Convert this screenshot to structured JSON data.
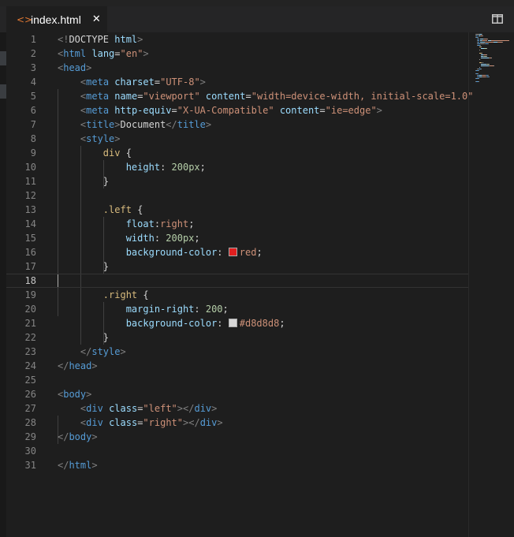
{
  "tab": {
    "icon": "code-file-icon",
    "icon_glyph": "<>",
    "filename": "index.html",
    "close_glyph": "✕"
  },
  "editor": {
    "current_line": 18,
    "lines": [
      {
        "n": "1",
        "tokens": [
          [
            "punc",
            "<!"
          ],
          [
            "txt",
            "DOCTYPE "
          ],
          [
            "attr",
            "html"
          ],
          [
            "punc",
            ">"
          ]
        ]
      },
      {
        "n": "2",
        "tokens": [
          [
            "punc",
            "<"
          ],
          [
            "tag",
            "html"
          ],
          [
            "txt",
            " "
          ],
          [
            "attr",
            "lang"
          ],
          [
            "txt",
            "="
          ],
          [
            "str",
            "\"en\""
          ],
          [
            "punc",
            ">"
          ]
        ]
      },
      {
        "n": "3",
        "tokens": [
          [
            "punc",
            "<"
          ],
          [
            "tag",
            "head"
          ],
          [
            "punc",
            ">"
          ]
        ]
      },
      {
        "n": "4",
        "tokens": [
          [
            "txt",
            "    "
          ],
          [
            "punc",
            "<"
          ],
          [
            "tag",
            "meta"
          ],
          [
            "txt",
            " "
          ],
          [
            "attr",
            "charset"
          ],
          [
            "txt",
            "="
          ],
          [
            "str",
            "\"UTF-8\""
          ],
          [
            "punc",
            ">"
          ]
        ]
      },
      {
        "n": "5",
        "tokens": [
          [
            "txt",
            "    "
          ],
          [
            "punc",
            "<"
          ],
          [
            "tag",
            "meta"
          ],
          [
            "txt",
            " "
          ],
          [
            "attr",
            "name"
          ],
          [
            "txt",
            "="
          ],
          [
            "str",
            "\"viewport\""
          ],
          [
            "txt",
            " "
          ],
          [
            "attr",
            "content"
          ],
          [
            "txt",
            "="
          ],
          [
            "str",
            "\"width=device-width, initial-scale=1.0\""
          ]
        ]
      },
      {
        "n": "6",
        "tokens": [
          [
            "txt",
            "    "
          ],
          [
            "punc",
            "<"
          ],
          [
            "tag",
            "meta"
          ],
          [
            "txt",
            " "
          ],
          [
            "attr",
            "http-equiv"
          ],
          [
            "txt",
            "="
          ],
          [
            "str",
            "\"X-UA-Compatible\""
          ],
          [
            "txt",
            " "
          ],
          [
            "attr",
            "content"
          ],
          [
            "txt",
            "="
          ],
          [
            "str",
            "\"ie=edge\""
          ],
          [
            "punc",
            ">"
          ]
        ]
      },
      {
        "n": "7",
        "tokens": [
          [
            "txt",
            "    "
          ],
          [
            "punc",
            "<"
          ],
          [
            "tag",
            "title"
          ],
          [
            "punc",
            ">"
          ],
          [
            "txt",
            "Document"
          ],
          [
            "punc",
            "</"
          ],
          [
            "tag",
            "title"
          ],
          [
            "punc",
            ">"
          ]
        ]
      },
      {
        "n": "8",
        "tokens": [
          [
            "txt",
            "    "
          ],
          [
            "punc",
            "<"
          ],
          [
            "tag",
            "style"
          ],
          [
            "punc",
            ">"
          ]
        ]
      },
      {
        "n": "9",
        "tokens": [
          [
            "txt",
            "        "
          ],
          [
            "sel",
            "div"
          ],
          [
            "txt",
            " {"
          ]
        ]
      },
      {
        "n": "10",
        "tokens": [
          [
            "txt",
            "            "
          ],
          [
            "prop",
            "height"
          ],
          [
            "txt",
            ": "
          ],
          [
            "num",
            "200px"
          ],
          [
            "txt",
            ";"
          ]
        ]
      },
      {
        "n": "11",
        "tokens": [
          [
            "txt",
            "        }"
          ]
        ]
      },
      {
        "n": "12",
        "tokens": []
      },
      {
        "n": "13",
        "tokens": [
          [
            "txt",
            "        "
          ],
          [
            "sel",
            ".left"
          ],
          [
            "txt",
            " {"
          ]
        ]
      },
      {
        "n": "14",
        "tokens": [
          [
            "txt",
            "            "
          ],
          [
            "prop",
            "float"
          ],
          [
            "txt",
            ":"
          ],
          [
            "str",
            "right"
          ],
          [
            "txt",
            ";"
          ]
        ]
      },
      {
        "n": "15",
        "tokens": [
          [
            "txt",
            "            "
          ],
          [
            "prop",
            "width"
          ],
          [
            "txt",
            ": "
          ],
          [
            "num",
            "200px"
          ],
          [
            "txt",
            ";"
          ]
        ]
      },
      {
        "n": "16",
        "tokens": [
          [
            "txt",
            "            "
          ],
          [
            "prop",
            "background-color"
          ],
          [
            "txt",
            ": "
          ],
          [
            "swatch",
            "#e01f1f"
          ],
          [
            "str",
            "red"
          ],
          [
            "txt",
            ";"
          ]
        ]
      },
      {
        "n": "17",
        "tokens": [
          [
            "txt",
            "        }"
          ]
        ]
      },
      {
        "n": "18",
        "tokens": []
      },
      {
        "n": "19",
        "tokens": [
          [
            "txt",
            "        "
          ],
          [
            "sel",
            ".right"
          ],
          [
            "txt",
            " {"
          ]
        ]
      },
      {
        "n": "20",
        "tokens": [
          [
            "txt",
            "            "
          ],
          [
            "prop",
            "margin-right"
          ],
          [
            "txt",
            ": "
          ],
          [
            "num",
            "200"
          ],
          [
            "txt",
            ";"
          ]
        ]
      },
      {
        "n": "21",
        "tokens": [
          [
            "txt",
            "            "
          ],
          [
            "prop",
            "background-color"
          ],
          [
            "txt",
            ": "
          ],
          [
            "swatch",
            "#d8d8d8"
          ],
          [
            "str",
            "#d8d8d8"
          ],
          [
            "txt",
            ";"
          ]
        ]
      },
      {
        "n": "22",
        "tokens": [
          [
            "txt",
            "        }"
          ]
        ]
      },
      {
        "n": "23",
        "tokens": [
          [
            "txt",
            "    "
          ],
          [
            "punc",
            "</"
          ],
          [
            "tag",
            "style"
          ],
          [
            "punc",
            ">"
          ]
        ]
      },
      {
        "n": "24",
        "tokens": [
          [
            "punc",
            "</"
          ],
          [
            "tag",
            "head"
          ],
          [
            "punc",
            ">"
          ]
        ]
      },
      {
        "n": "25",
        "tokens": []
      },
      {
        "n": "26",
        "tokens": [
          [
            "punc",
            "<"
          ],
          [
            "tag",
            "body"
          ],
          [
            "punc",
            ">"
          ]
        ]
      },
      {
        "n": "27",
        "tokens": [
          [
            "txt",
            "    "
          ],
          [
            "punc",
            "<"
          ],
          [
            "tag",
            "div"
          ],
          [
            "txt",
            " "
          ],
          [
            "attr",
            "class"
          ],
          [
            "txt",
            "="
          ],
          [
            "str",
            "\"left\""
          ],
          [
            "punc",
            "></"
          ],
          [
            "tag",
            "div"
          ],
          [
            "punc",
            ">"
          ]
        ]
      },
      {
        "n": "28",
        "tokens": [
          [
            "txt",
            "    "
          ],
          [
            "punc",
            "<"
          ],
          [
            "tag",
            "div"
          ],
          [
            "txt",
            " "
          ],
          [
            "attr",
            "class"
          ],
          [
            "txt",
            "="
          ],
          [
            "str",
            "\"right\""
          ],
          [
            "punc",
            "></"
          ],
          [
            "tag",
            "div"
          ],
          [
            "punc",
            ">"
          ]
        ]
      },
      {
        "n": "29",
        "tokens": [
          [
            "punc",
            "</"
          ],
          [
            "tag",
            "body"
          ],
          [
            "punc",
            ">"
          ]
        ]
      },
      {
        "n": "30",
        "tokens": []
      },
      {
        "n": "31",
        "tokens": [
          [
            "punc",
            "</"
          ],
          [
            "tag",
            "html"
          ],
          [
            "punc",
            ">"
          ]
        ]
      }
    ]
  },
  "colors": {
    "background": "#1e1e1e",
    "tag": "#569cd6",
    "attribute": "#9cdcfe",
    "string": "#ce9178",
    "selector": "#d7ba7d",
    "number": "#b5cea8"
  }
}
